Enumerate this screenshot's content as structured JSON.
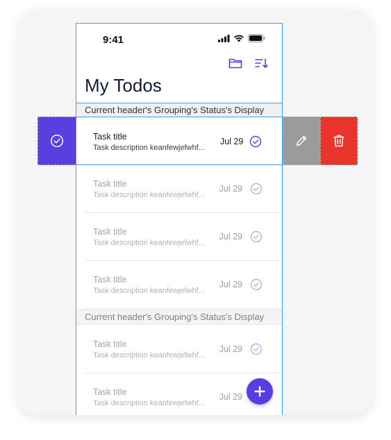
{
  "status_bar": {
    "time": "9:41"
  },
  "header": {
    "title": "My Todos",
    "folder_icon": "folder-icon",
    "sort_icon": "sort-icon"
  },
  "sections": [
    {
      "label": "Current header's Grouping's Status's Display"
    },
    {
      "label": "Current header's Grouping's Status's Display"
    }
  ],
  "swiped_row": {
    "title": "Task title",
    "description": "Task description keanfewjefwhf...",
    "date": "Jul 29"
  },
  "rows": [
    {
      "title": "Task title",
      "description": "Task description keanfewjefwhf...",
      "date": "Jul 29"
    },
    {
      "title": "Task title",
      "description": "Task description keanfewjefwhf...",
      "date": "Jul 29"
    },
    {
      "title": "Task title",
      "description": "Task description keanfewjefwhf...",
      "date": "Jul 29"
    },
    {
      "title": "Task title",
      "description": "Task description keanfewjefwhf...",
      "date": "Jul 29"
    },
    {
      "title": "Task title",
      "description": "Task description keanfewjefwhf...",
      "date": "Jul 29"
    }
  ],
  "colors": {
    "accent": "#5a3de0",
    "delete": "#e8352b",
    "edit": "#9b9b9e"
  }
}
